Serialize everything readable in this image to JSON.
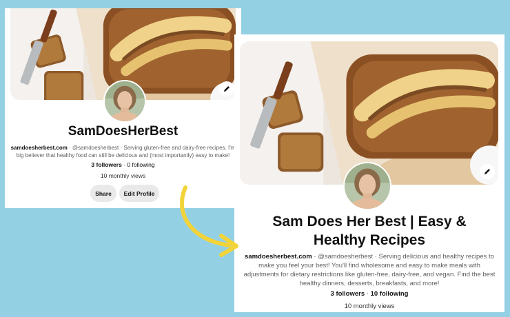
{
  "before": {
    "name": "SamDoesHerBest",
    "website": "samdoesherbest.com",
    "handle": "@samdoesherbest",
    "separator": " · ",
    "description": "Serving gluten-free and dairy-free recipes. I'm big believer that healthy food can still be delicious and (most importantly) easy to make!",
    "followers_count": "3 followers",
    "stat_separator": " · ",
    "following": "0 following",
    "views": "10 monthly views",
    "share_label": "Share",
    "edit_profile_label": "Edit Profile"
  },
  "after": {
    "name": "Sam Does Her Best | Easy & Healthy Recipes",
    "website": "samdoesherbest.com",
    "handle": "@samdoesherbest",
    "separator": " · ",
    "description": "Serving delicious and healthy recipes to make you feel your best! You'll find wholesome and easy to make meals with adjustments for dietary restrictions like gluten-free, dairy-free, and vegan. Find the best healthy dinners, desserts, breakfasts, and more!",
    "followers_count": "3 followers",
    "stat_separator": " · ",
    "following": "10 following",
    "views": "10 monthly views"
  },
  "icons": {
    "edit_cover": "pencil-icon",
    "arrow": "curved-arrow-icon"
  },
  "colors": {
    "background": "#94d0e4",
    "arrow": "#f2d43a"
  }
}
